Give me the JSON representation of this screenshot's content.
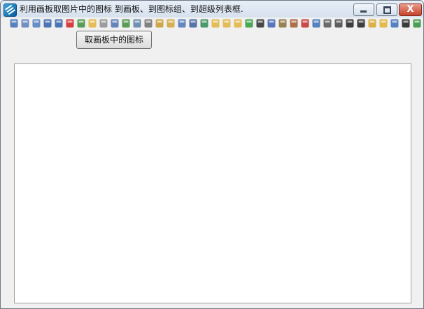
{
  "window": {
    "title": "利用画板取图片中的图标 到画板、到图标组、到超级列表框.",
    "close_glyph": "X"
  },
  "toolbar": {
    "icons": [
      {
        "name": "cut-icon",
        "color": "#3a6db5"
      },
      {
        "name": "copy-icon",
        "color": "#5b7fb8"
      },
      {
        "name": "paste-icon",
        "color": "#4c7cc0"
      },
      {
        "name": "undo-icon",
        "color": "#2f5fa8"
      },
      {
        "name": "redo-icon",
        "color": "#2f5fa8"
      },
      {
        "name": "delete-icon",
        "color": "#d02020"
      },
      {
        "name": "image-icon",
        "color": "#3b8f3b"
      },
      {
        "name": "open-folder-icon",
        "color": "#e3b33a"
      },
      {
        "name": "edit-page-icon",
        "color": "#8d8d8d"
      },
      {
        "name": "properties-icon",
        "color": "#4e73b0"
      },
      {
        "name": "pointer-icon",
        "color": "#3f8c3a"
      },
      {
        "name": "zoom-icon",
        "color": "#5c7fa6"
      },
      {
        "name": "print-icon",
        "color": "#6f6f6f"
      },
      {
        "name": "lock-folder-icon",
        "color": "#c89a2e"
      },
      {
        "name": "lock-icon",
        "color": "#d2a336"
      },
      {
        "name": "box-icon",
        "color": "#4c73b7"
      },
      {
        "name": "save-icon",
        "color": "#3d5d9c"
      },
      {
        "name": "save-all-icon",
        "color": "#2f8a56"
      },
      {
        "name": "new-folder-icon",
        "color": "#e0b23c"
      },
      {
        "name": "folder-add-icon",
        "color": "#e0b23c"
      },
      {
        "name": "folder-remove-icon",
        "color": "#e0b23c"
      },
      {
        "name": "green-cube-icon",
        "color": "#2e9a3a"
      },
      {
        "name": "grid-icon",
        "color": "#2b2b2b"
      },
      {
        "name": "text-icon",
        "color": "#3b5fb0"
      },
      {
        "name": "brush-icon",
        "color": "#8a6d3b"
      },
      {
        "name": "paint-icon",
        "color": "#a0592e"
      },
      {
        "name": "clear-icon",
        "color": "#c22b2b"
      },
      {
        "name": "page-icon",
        "color": "#3b6fb5"
      },
      {
        "name": "select-icon",
        "color": "#555555"
      },
      {
        "name": "crop-icon",
        "color": "#444444"
      },
      {
        "name": "frame-icon",
        "color": "#1f1f1f"
      },
      {
        "name": "frame-bold-icon",
        "color": "#1f1f1f"
      },
      {
        "name": "effects-icon",
        "color": "#d7a52a"
      },
      {
        "name": "star-icon",
        "color": "#e2b02f"
      },
      {
        "name": "network-icon",
        "color": "#3a6fb8"
      },
      {
        "name": "monitor-icon",
        "color": "#1b1b1b"
      },
      {
        "name": "exchange-icon",
        "color": "#2e8f3a"
      }
    ]
  },
  "main": {
    "canvas_action_button": "取画板中的图标"
  }
}
